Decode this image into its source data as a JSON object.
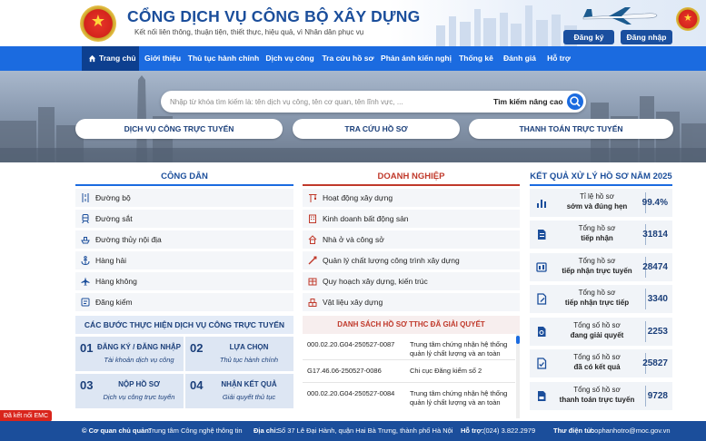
{
  "header": {
    "title": "CỔNG DỊCH VỤ CÔNG BỘ XÂY DỰNG",
    "subtitle": "Kết nối liên thông, thuận tiện, thiết thực, hiệu quả, vì Nhân dân phục vụ",
    "register_label": "Đăng ký",
    "login_label": "Đăng nhập"
  },
  "nav": {
    "items": [
      "Trang chủ",
      "Giới thiệu",
      "Thủ tục hành chính",
      "Dịch vụ công",
      "Tra cứu hồ sơ",
      "Phản ánh kiến nghị",
      "Thống kê",
      "Đánh giá",
      "Hỗ trợ"
    ]
  },
  "search": {
    "placeholder": "Nhập từ khóa tìm kiếm là: tên dịch vụ công, tên cơ quan, tên lĩnh vực, ...",
    "advanced_label": "Tìm kiếm nâng cao"
  },
  "quick_links": [
    "DỊCH VỤ CÔNG TRỰC TUYẾN",
    "TRA CỨU HỒ SƠ",
    "THANH TOÁN TRỰC TUYẾN"
  ],
  "citizen": {
    "title": "CÔNG DÂN",
    "items": [
      "Đường bộ",
      "Đường sắt",
      "Đường thủy nội địa",
      "Hàng hải",
      "Hàng không",
      "Đăng kiểm"
    ]
  },
  "business": {
    "title": "DOANH NGHIỆP",
    "items": [
      "Hoạt động xây dựng",
      "Kinh doanh bất động sản",
      "Nhà ở và công sở",
      "Quản lý chất lượng công trình xây dựng",
      "Quy hoạch xây dựng, kiến trúc",
      "Vật liệu xây dựng"
    ]
  },
  "steps": {
    "title": "CÁC BƯỚC THỰC HIỆN DỊCH VỤ CÔNG TRỰC TUYẾN",
    "items": [
      {
        "num": "01",
        "title": "ĐĂNG KÝ / ĐĂNG NHẬP",
        "desc": "Tài khoản dịch vụ công"
      },
      {
        "num": "02",
        "title": "LỰA CHỌN",
        "desc": "Thủ tục hành chính"
      },
      {
        "num": "03",
        "title": "NỘP HỒ SƠ",
        "desc": "Dịch vụ công trực tuyến"
      },
      {
        "num": "04",
        "title": "NHẬN KẾT QUẢ",
        "desc": "Giải quyết thủ tục"
      }
    ]
  },
  "resolved": {
    "title": "DANH SÁCH HỒ SƠ TTHC ĐÃ GIẢI QUYẾT",
    "rows": [
      {
        "code": "000.02.20.G04-250527-0087",
        "org": "Trung tâm chứng nhận hệ thống quản lý chất lượng và an toàn"
      },
      {
        "code": "G17.46.06-250527-0086",
        "org": "Chi cục Đăng kiểm số 2"
      },
      {
        "code": "000.02.20.G04-250527-0084",
        "org": "Trung tâm chứng nhận hệ thống quản lý chất lượng và an toàn"
      }
    ]
  },
  "stats": {
    "title": "KẾT QUẢ XỬ LÝ HỒ SƠ NĂM 2025",
    "items": [
      {
        "line1": "Tỉ lệ hồ sơ",
        "line2": "sớm và đúng hẹn",
        "value": "99.4%"
      },
      {
        "line1": "Tổng hồ sơ",
        "line2": "tiếp nhận",
        "value": "31814"
      },
      {
        "line1": "Tổng hồ sơ",
        "line2": "tiếp nhận trực tuyến",
        "value": "28474"
      },
      {
        "line1": "Tổng hồ sơ",
        "line2": "tiếp nhận trực tiếp",
        "value": "3340"
      },
      {
        "line1": "Tổng số hồ sơ",
        "line2": "đang giải quyết",
        "value": "2253"
      },
      {
        "line1": "Tổng số hồ sơ",
        "line2": "đã có kết quả",
        "value": "25827"
      },
      {
        "line1": "Tổng số hồ sơ",
        "line2": "thanh toán trực tuyến",
        "value": "9728"
      }
    ]
  },
  "footer": {
    "agency_label": "© Cơ quan chủ quản:",
    "agency": "Trung tâm Công nghệ thông tin",
    "address_label": "Địa chỉ:",
    "address": "Số 37 Lê Đại Hành, quận Hai Bà Trưng, thành phố Hà Nội",
    "phone_label": "Hỗ trợ:",
    "phone": "(024) 3.822.2979",
    "email_label": "Thư điện tử:",
    "email": "bophanhotro@moc.gov.vn"
  },
  "emc_badge": "Đã kết nối EMC",
  "colors": {
    "primary": "#1b6be0",
    "dark": "#1b4e9b",
    "business": "#c0392b"
  }
}
